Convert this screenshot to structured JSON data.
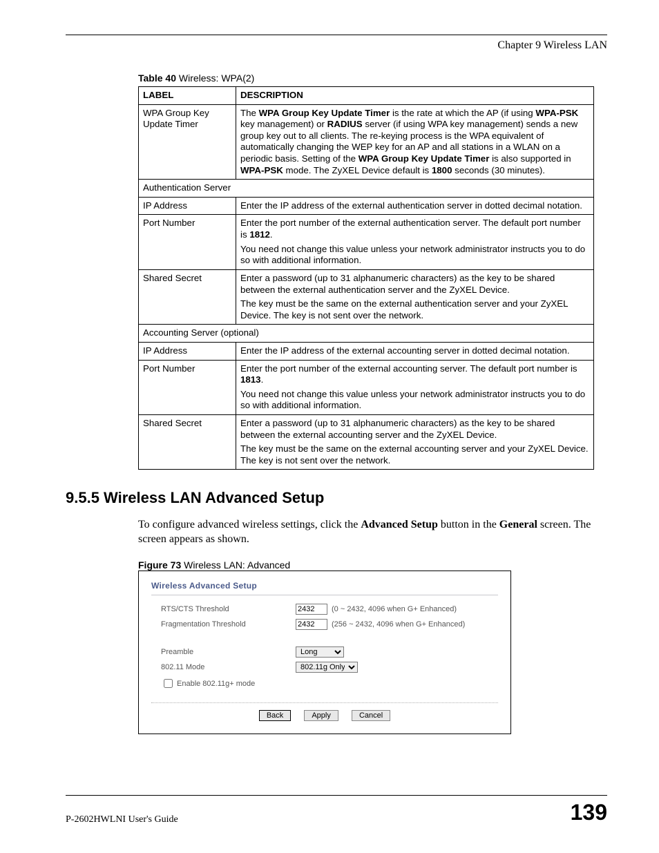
{
  "header": {
    "chapter": "Chapter 9 Wireless LAN"
  },
  "table40": {
    "caption_bold": "Table 40",
    "caption_rest": "   Wireless: WPA(2)",
    "head_label": "LABEL",
    "head_desc": "DESCRIPTION",
    "rows": {
      "r1_label": "WPA Group Key Update Timer",
      "r1_desc_pre": "The ",
      "r1_b1": "WPA Group Key Update Timer",
      "r1_mid1": " is the rate at which the AP (if using ",
      "r1_b2": "WPA-PSK",
      "r1_mid2": " key management) or ",
      "r1_b3": "RADIUS",
      "r1_mid3": " server (if using WPA key management) sends a new group key out to all clients. The re-keying process is the WPA equivalent of automatically changing the WEP key for an AP and all stations in a WLAN on a periodic basis. Setting of the ",
      "r1_b4": "WPA Group Key Update Timer",
      "r1_mid4": " is also supported in ",
      "r1_b5": "WPA-PSK",
      "r1_mid5": " mode. The ZyXEL Device default is ",
      "r1_b6": "1800",
      "r1_mid6": " seconds (30 minutes).",
      "r2_full": "Authentication Server",
      "r3_label": "IP Address",
      "r3_desc": "Enter the IP address of the external authentication server in dotted decimal notation.",
      "r4_label": "Port Number",
      "r4_p1_pre": "Enter the port number of the external authentication server. The default port number is ",
      "r4_p1_b": "1812",
      "r4_p1_post": ".",
      "r4_p2": "You need not change this value unless your network administrator instructs you to do so with additional information.",
      "r5_label": "Shared Secret",
      "r5_p1": "Enter a password (up to 31 alphanumeric characters) as the key to be shared between the external authentication server and the ZyXEL Device.",
      "r5_p2": "The key must be the same on the external authentication server and your ZyXEL Device. The key is not sent over the network.",
      "r6_full": "Accounting Server (optional)",
      "r7_label": "IP Address",
      "r7_desc": "Enter the IP address of the external accounting server in dotted decimal notation.",
      "r8_label": "Port Number",
      "r8_p1_pre": "Enter the port number of the external accounting server. The default port number is ",
      "r8_p1_b": "1813",
      "r8_p1_post": ".",
      "r8_p2": "You need not change this value unless your network administrator instructs you to do so with additional information.",
      "r9_label": "Shared Secret",
      "r9_p1": "Enter a password (up to 31 alphanumeric characters) as the key to be shared between the external accounting server and the ZyXEL Device.",
      "r9_p2": "The key must be the same on the external accounting server and your ZyXEL Device. The key is not sent over the network."
    }
  },
  "section": {
    "heading": "9.5.5  Wireless LAN Advanced Setup",
    "para_pre": "To configure advanced wireless settings, click the ",
    "para_b1": "Advanced Setup",
    "para_mid": " button in the ",
    "para_b2": "General",
    "para_post": " screen. The screen appears as shown."
  },
  "figure73": {
    "caption_bold": "Figure 73",
    "caption_rest": "   Wireless LAN: Advanced",
    "title": "Wireless Advanced Setup",
    "rts_label": "RTS/CTS Threshold",
    "rts_value": "2432",
    "rts_hint": "(0 ~ 2432, 4096 when G+ Enhanced)",
    "frag_label": "Fragmentation Threshold",
    "frag_value": "2432",
    "frag_hint": "(256 ~ 2432, 4096 when G+ Enhanced)",
    "preamble_label": "Preamble",
    "preamble_value": "Long",
    "mode_label": "802.11 Mode",
    "mode_value": "802.11g Only",
    "enable_gplus": "Enable 802.11g+ mode",
    "btn_back": "Back",
    "btn_apply": "Apply",
    "btn_cancel": "Cancel"
  },
  "footer": {
    "guide": "P-2602HWLNI User's Guide",
    "page": "139"
  }
}
